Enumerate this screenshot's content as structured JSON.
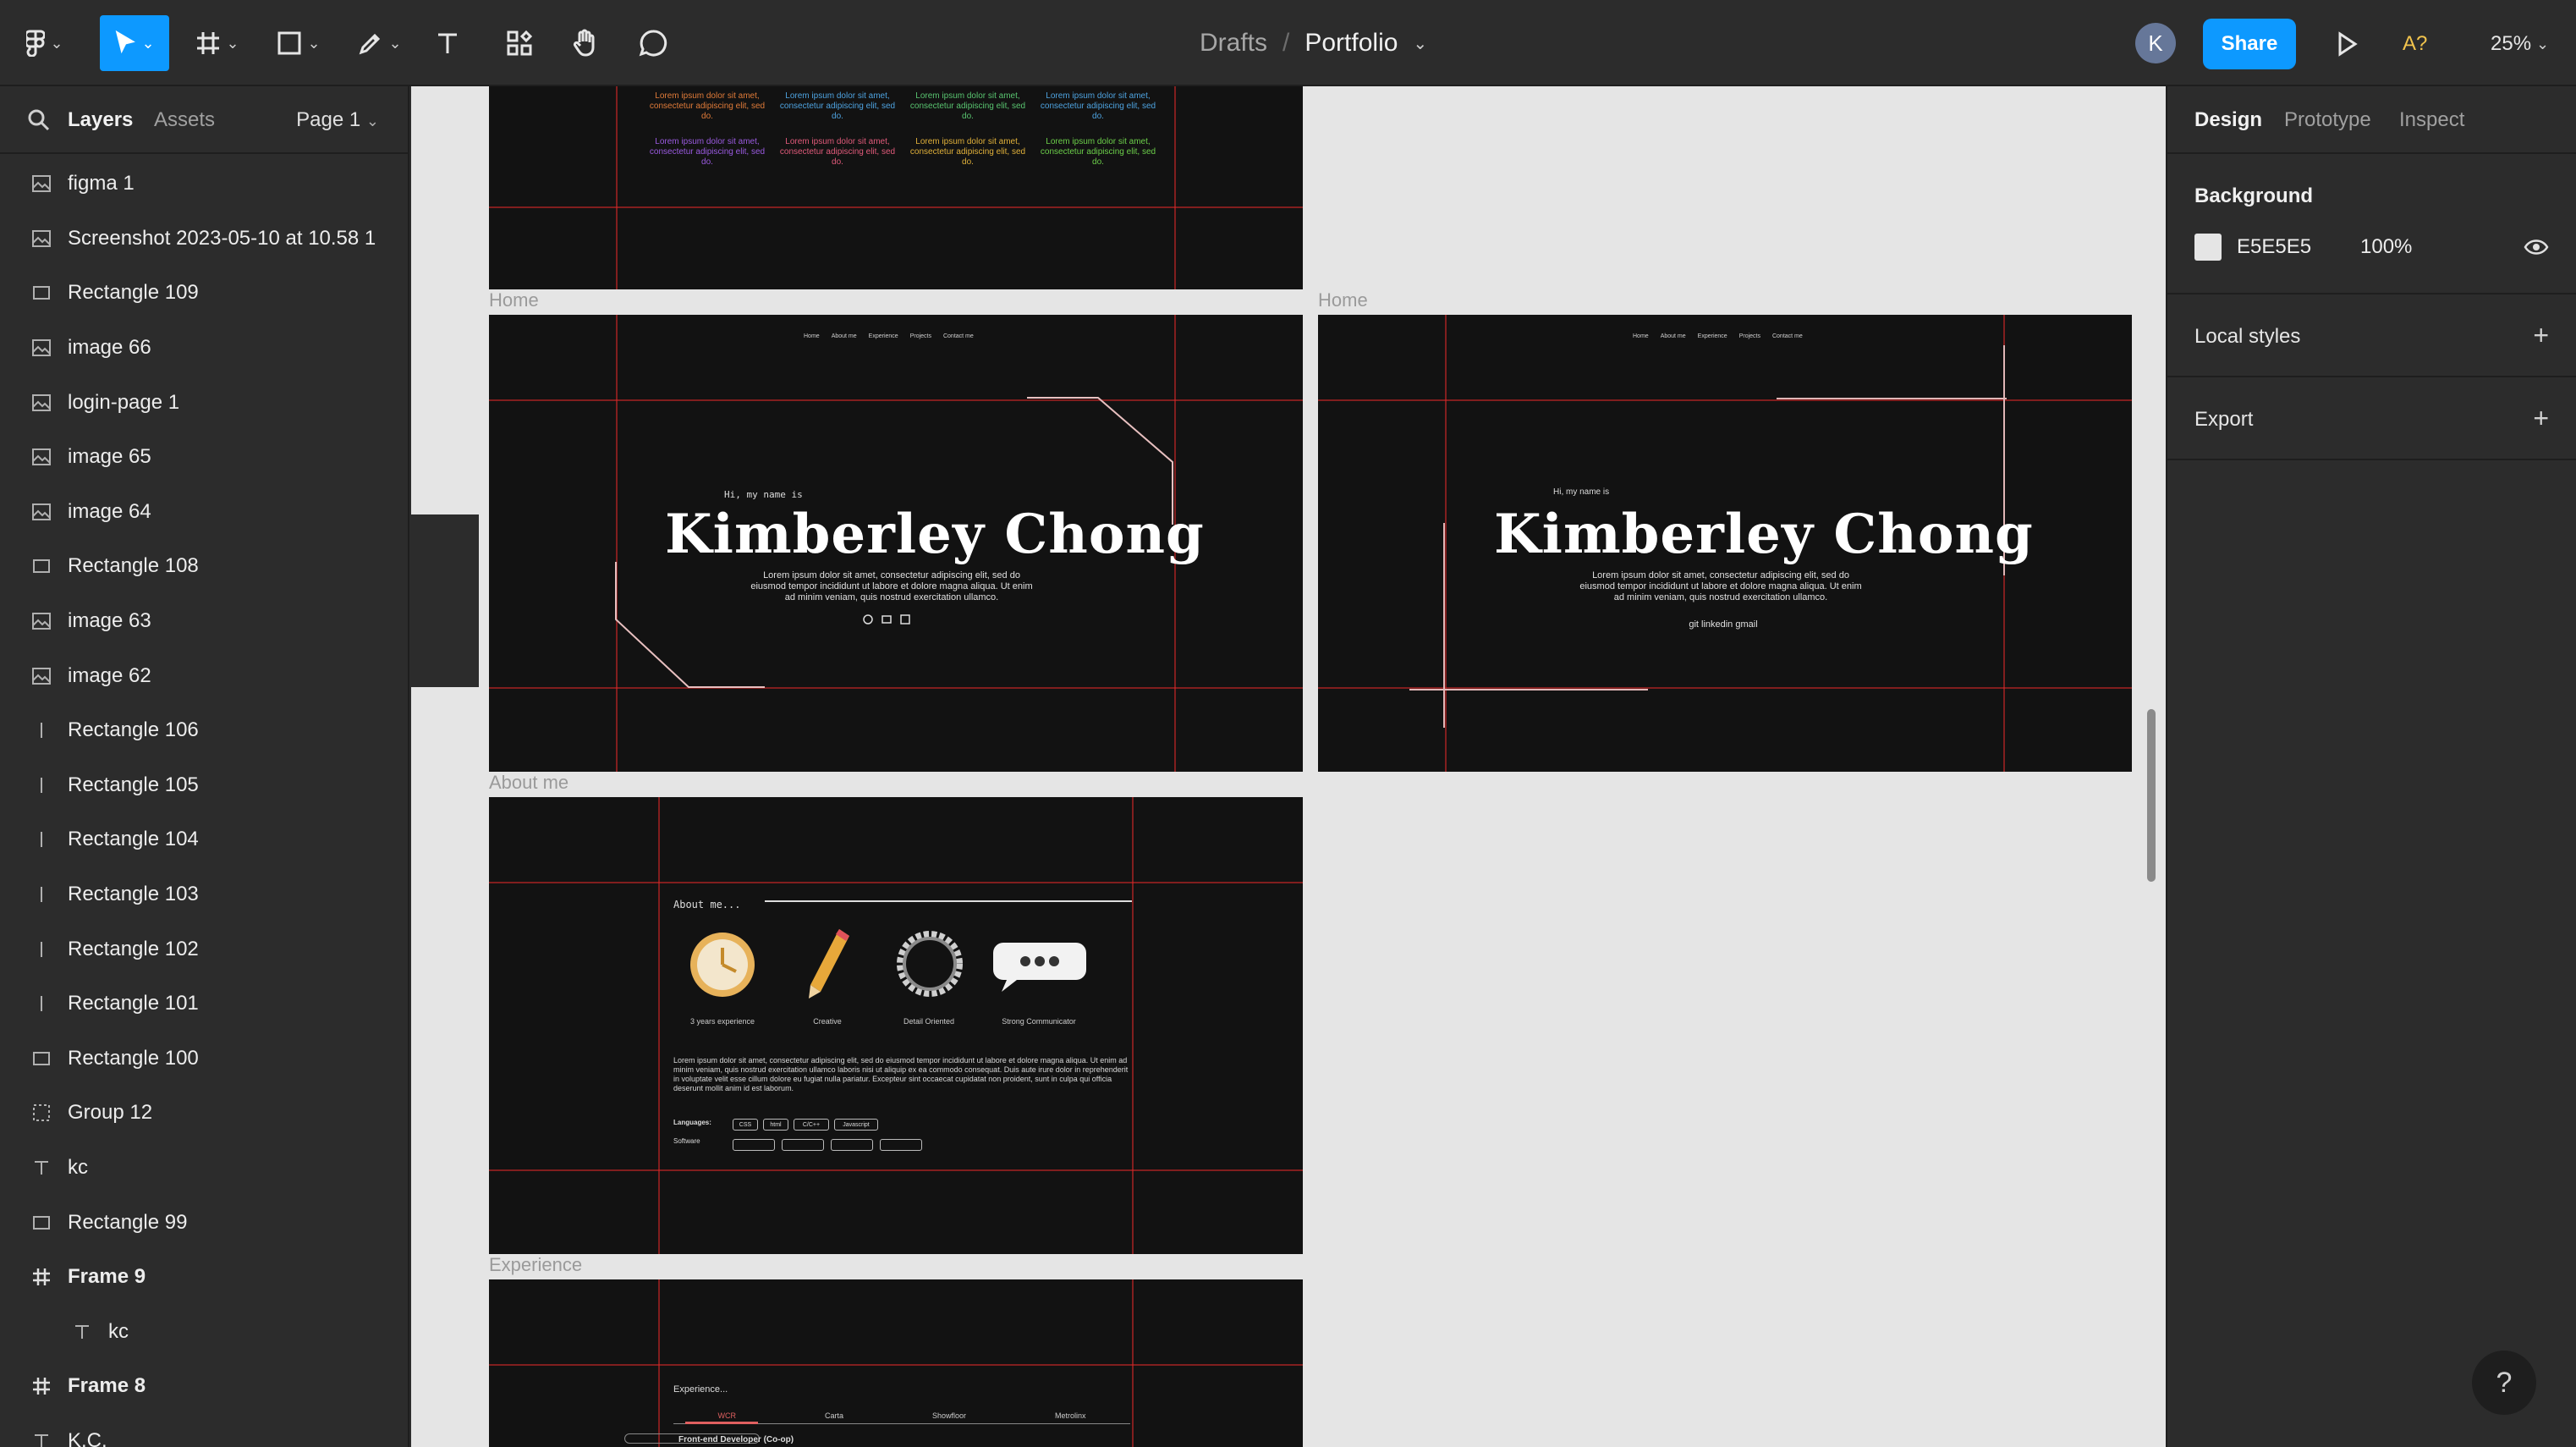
{
  "toolbar": {
    "breadcrumb_parent": "Drafts",
    "breadcrumb_separator": "/",
    "file_name": "Portfolio",
    "avatar_initial": "K",
    "share_label": "Share",
    "a11y_label": "A?",
    "zoom_label": "25%"
  },
  "left_panel": {
    "tabs": [
      "Layers",
      "Assets"
    ],
    "page_label": "Page 1",
    "layers": [
      {
        "name": "figma 1",
        "icon": "image-icon"
      },
      {
        "name": "Screenshot 2023-05-10 at 10.58 1",
        "icon": "image-icon"
      },
      {
        "name": "Rectangle 109",
        "icon": "rectangle-icon"
      },
      {
        "name": "image 66",
        "icon": "image-icon"
      },
      {
        "name": "login-page 1",
        "icon": "image-icon"
      },
      {
        "name": "image 65",
        "icon": "image-icon"
      },
      {
        "name": "image 64",
        "icon": "image-icon"
      },
      {
        "name": "Rectangle 108",
        "icon": "rectangle-icon"
      },
      {
        "name": "image 63",
        "icon": "image-icon"
      },
      {
        "name": "image 62",
        "icon": "image-icon"
      },
      {
        "name": "Rectangle 106",
        "icon": "line-icon"
      },
      {
        "name": "Rectangle 105",
        "icon": "line-icon"
      },
      {
        "name": "Rectangle 104",
        "icon": "line-icon"
      },
      {
        "name": "Rectangle 103",
        "icon": "line-icon"
      },
      {
        "name": "Rectangle 102",
        "icon": "line-icon"
      },
      {
        "name": "Rectangle 101",
        "icon": "line-icon"
      },
      {
        "name": "Rectangle 100",
        "icon": "rectangle-icon"
      },
      {
        "name": "Group 12",
        "icon": "group-icon"
      },
      {
        "name": "kc",
        "icon": "text-icon"
      },
      {
        "name": "Rectangle 99",
        "icon": "rectangle-icon"
      },
      {
        "name": "Frame 9",
        "icon": "frame-icon"
      },
      {
        "name": "kc",
        "icon": "text-icon"
      },
      {
        "name": "Frame 8",
        "icon": "frame-icon"
      },
      {
        "name": "K.C.",
        "icon": "text-icon"
      }
    ]
  },
  "canvas": {
    "frame_labels": {
      "home_1": "Home",
      "home_2": "Home",
      "about": "About me",
      "experience": "Experience"
    },
    "home_nav": [
      "Home",
      "About me",
      "Experience",
      "Projects",
      "Contact me"
    ],
    "greeting_1": "Hi, my name is",
    "greeting_2": "Hi, my name is",
    "hero_name_1": "Kimberley Chong",
    "hero_name_2": "Kimberley Chong",
    "hero_lorem_1": "Lorem ipsum dolor sit amet, consectetur adipiscing elit, sed do eiusmod tempor incididunt ut labore et dolore magna aliqua. Ut enim ad minim veniam, quis nostrud exercitation ullamco.",
    "hero_lorem_2": "Lorem ipsum dolor sit amet, consectetur adipiscing elit, sed do eiusmod tempor incididunt ut labore et dolore magna aliqua. Ut enim ad minim veniam, quis nostrud exercitation ullamco.",
    "contact_links": "git linkedin gmail",
    "top_lorem": "Lorem ipsum dolor sit amet, consectetur adipiscing elit, sed do.",
    "about_title": "About me...",
    "about_items": [
      "3 years experience",
      "Creative",
      "Detail Oriented",
      "Strong Communicator"
    ],
    "about_lorem": "Lorem ipsum dolor sit amet, consectetur adipiscing elit, sed do eiusmod tempor incididunt ut labore et dolore magna aliqua. Ut enim ad minim veniam, quis nostrud exercitation ullamco laboris nisi ut aliquip ex ea commodo consequat. Duis aute irure dolor in reprehenderit in voluptate velit esse cillum dolore eu fugiat nulla pariatur. Excepteur sint occaecat cupidatat non proident, sunt in culpa qui officia deserunt mollit anim id est laborum.",
    "languages_label": "Languages:",
    "languages": [
      "CSS",
      "html",
      "C/C++",
      "Javascript"
    ],
    "software_label": "Software",
    "experience_title": "Experience...",
    "experience_tabs": [
      "WCR",
      "Carta",
      "Showfloor",
      "Metrolinx"
    ],
    "experience_role": "Front-end Developer (Co-op)"
  },
  "right_panel": {
    "tabs": [
      "Design",
      "Prototype",
      "Inspect"
    ],
    "background_title": "Background",
    "background_hex": "E5E5E5",
    "background_opacity": "100%",
    "local_styles_title": "Local styles",
    "export_title": "Export"
  },
  "help_label": "?",
  "colors": {
    "accent": "#0d99ff",
    "canvas": "#e5e5e5",
    "frame": "#121212",
    "guide": "#dc2828",
    "panel": "#2c2c2c"
  }
}
